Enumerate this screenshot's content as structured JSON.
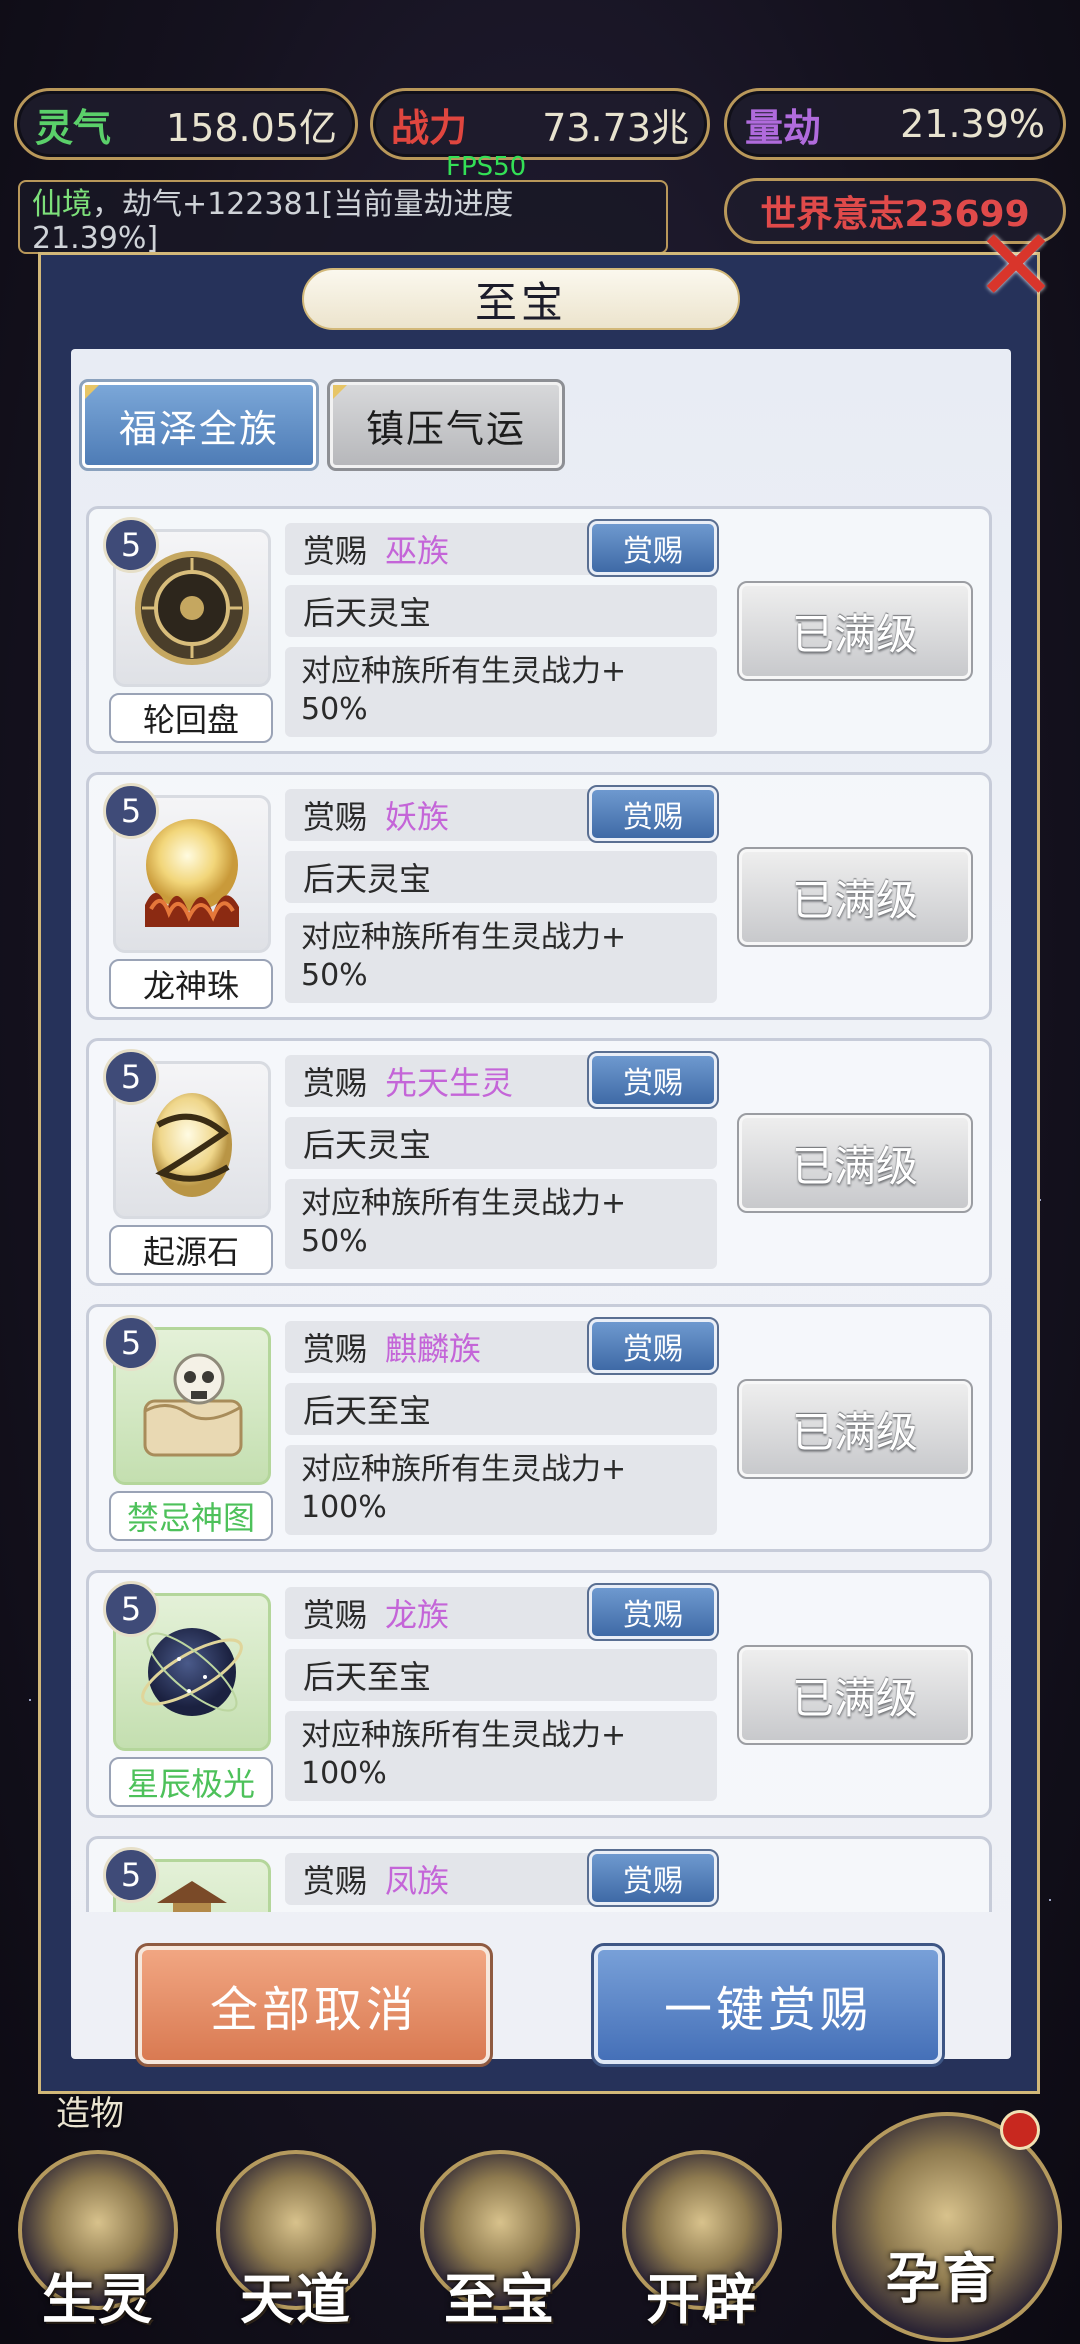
{
  "top_stats": [
    {
      "label": "灵气",
      "value": "158.05亿",
      "color": "#5bd06a"
    },
    {
      "label": "战力",
      "value": "73.73兆",
      "color": "#e0463f"
    },
    {
      "label": "量劫",
      "value": "21.39%",
      "color": "#b06bdc"
    }
  ],
  "fps": "FPS50",
  "message": {
    "prefix": "仙境",
    "text": "，劫气+122381[当前量劫进度",
    "line2": "21.39%]"
  },
  "world_will": "世界意志23699",
  "close_icon": "close-x-icon",
  "panel": {
    "title": "至宝",
    "tabs": [
      "福泽全族",
      "镇压气运"
    ]
  },
  "items": [
    {
      "level": "5",
      "name": "轮回盘",
      "name_color": "default",
      "reward_label": "赏赐",
      "tribe": "巫族",
      "button": "赏赐",
      "type": "后天灵宝",
      "effect": "对应种族所有生灵战力+",
      "effect_value": "50%",
      "status": "已满级",
      "icon": "wheel-disc-icon"
    },
    {
      "level": "5",
      "name": "龙神珠",
      "name_color": "default",
      "reward_label": "赏赐",
      "tribe": "妖族",
      "button": "赏赐",
      "type": "后天灵宝",
      "effect": "对应种族所有生灵战力+",
      "effect_value": "50%",
      "status": "已满级",
      "icon": "dragon-pearl-icon"
    },
    {
      "level": "5",
      "name": "起源石",
      "name_color": "default",
      "reward_label": "赏赐",
      "tribe": "先天生灵",
      "button": "赏赐",
      "type": "后天灵宝",
      "effect": "对应种族所有生灵战力+",
      "effect_value": "50%",
      "status": "已满级",
      "icon": "origin-stone-icon"
    },
    {
      "level": "5",
      "name": "禁忌神图",
      "name_color": "green",
      "reward_label": "赏赐",
      "tribe": "麒麟族",
      "button": "赏赐",
      "type": "后天至宝",
      "effect": "对应种族所有生灵战力+",
      "effect_value": "100%",
      "status": "已满级",
      "icon": "forbidden-scroll-icon"
    },
    {
      "level": "5",
      "name": "星辰极光",
      "name_color": "green",
      "reward_label": "赏赐",
      "tribe": "龙族",
      "button": "赏赐",
      "type": "后天至宝",
      "effect": "对应种族所有生灵战力+",
      "effect_value": "100%",
      "status": "已满级",
      "icon": "star-orb-icon"
    },
    {
      "level": "5",
      "name": "",
      "name_color": "green",
      "reward_label": "赏赐",
      "tribe": "凤族",
      "button": "赏赐",
      "type": "",
      "effect": "",
      "effect_value": "",
      "status": "",
      "icon": "pagoda-icon"
    }
  ],
  "buttons": {
    "cancel_all": "全部取消",
    "one_click": "一键赏赐"
  },
  "residue_text": "造物",
  "nav": [
    "生灵",
    "天道",
    "至宝",
    "开辟",
    "孕育"
  ]
}
